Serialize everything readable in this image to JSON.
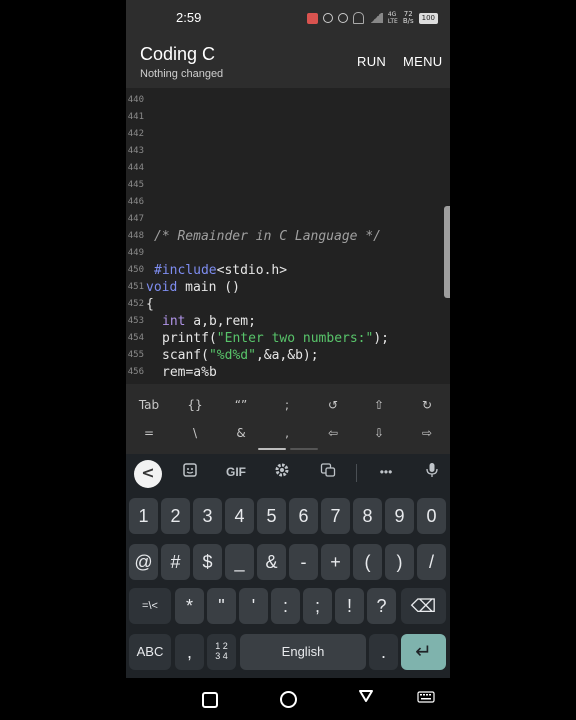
{
  "status": {
    "time": "2:59",
    "net_top": "4G",
    "net_bottom": "LTE",
    "speed_value": "72",
    "speed_unit": "B/s",
    "battery": "100"
  },
  "app": {
    "title": "Coding C",
    "subtitle": "Nothing changed",
    "run_label": "RUN",
    "menu_label": "MENU"
  },
  "editor": {
    "lines": [
      {
        "n": "440",
        "code": ""
      },
      {
        "n": "441",
        "code": ""
      },
      {
        "n": "442",
        "code": ""
      },
      {
        "n": "443",
        "code": ""
      },
      {
        "n": "444",
        "code": ""
      },
      {
        "n": "445",
        "code": ""
      },
      {
        "n": "446",
        "code": ""
      },
      {
        "n": "447",
        "code": ""
      },
      {
        "n": "448",
        "code": "/* Remainder in C Language */"
      },
      {
        "n": "449",
        "code": ""
      },
      {
        "n": "450",
        "code": "#include<stdio.h>"
      },
      {
        "n": "451",
        "code": "void main ()"
      },
      {
        "n": "452",
        "code": "{"
      },
      {
        "n": "453",
        "code": "int a,b,rem;"
      },
      {
        "n": "454",
        "code": "printf(\"Enter two numbers:\");"
      },
      {
        "n": "455",
        "code": "scanf(\"%d%d\",&a,&b);"
      },
      {
        "n": "456",
        "code": "rem=a%b"
      }
    ],
    "tokens": {
      "comment": "/* Remainder in C Language */",
      "include_kw": "#include",
      "include_rest": "<stdio.h>",
      "void_kw": "void",
      "main_rest": " main ()",
      "brace": "{",
      "int_kw": "int",
      "int_rest": " a,b,rem;",
      "printf_fn": "printf(",
      "printf_str": "\"Enter two numbers:\"",
      "printf_end": ");",
      "scanf_fn": "scanf(",
      "scanf_str": "\"%d%d\"",
      "scanf_end": ",&a,&b);",
      "rem_line": "rem=a%b"
    }
  },
  "symbols": {
    "row1": [
      "Tab",
      "{}",
      "“”",
      ";",
      "↺",
      "⇧",
      "↻"
    ],
    "row2": [
      "=",
      "\\",
      "&",
      ",",
      "⇦",
      "⇩",
      "⇨"
    ]
  },
  "keyboard": {
    "toolbar": {
      "back": "<",
      "gif": "GIF",
      "more": "•••"
    },
    "numbers": [
      "1",
      "2",
      "3",
      "4",
      "5",
      "6",
      "7",
      "8",
      "9",
      "0"
    ],
    "symbols_row": [
      "@",
      "#",
      "$",
      "_",
      "&",
      "-",
      "+",
      "(",
      ")",
      "/"
    ],
    "row3": [
      "=\\<",
      "*",
      "\"",
      "'",
      ":",
      ";",
      "!",
      "?"
    ],
    "abc": "ABC",
    "comma": ",",
    "frac_top": "1 2",
    "frac_bottom": "3 4",
    "space": "English",
    "period": ".",
    "enter": "↵",
    "backspace": "⌫"
  },
  "colors": {
    "enter_key": "#7fb3ad",
    "keyword": "#7e8df0",
    "string": "#58c46a"
  }
}
